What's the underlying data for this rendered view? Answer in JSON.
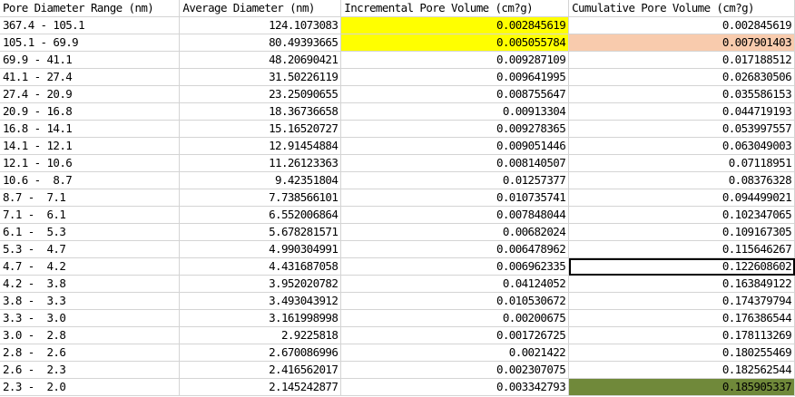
{
  "headers": [
    "Pore Diameter Range (nm)",
    "Average Diameter (nm)",
    "Incremental Pore Volume (cm?g)",
    "Cumulative Pore Volume (cm?g)"
  ],
  "rows": [
    [
      "367.4 - 105.1",
      "124.1073083",
      "0.002845619",
      "0.002845619"
    ],
    [
      "105.1 - 69.9",
      "80.49393665",
      "0.005055784",
      "0.007901403"
    ],
    [
      "69.9 - 41.1",
      "48.20690421",
      "0.009287109",
      "0.017188512"
    ],
    [
      "41.1 - 27.4",
      "31.50226119",
      "0.009641995",
      "0.026830506"
    ],
    [
      "27.4 - 20.9",
      "23.25090655",
      "0.008755647",
      "0.035586153"
    ],
    [
      "20.9 - 16.8",
      "18.36736658",
      "0.00913304",
      "0.044719193"
    ],
    [
      "16.8 - 14.1",
      "15.16520727",
      "0.009278365",
      "0.053997557"
    ],
    [
      "14.1 - 12.1",
      "12.91454884",
      "0.009051446",
      "0.063049003"
    ],
    [
      "12.1 - 10.6",
      "11.26123363",
      "0.008140507",
      "0.07118951"
    ],
    [
      "10.6 -  8.7",
      "9.42351804",
      "0.01257377",
      "0.08376328"
    ],
    [
      "8.7 -  7.1",
      "7.738566101",
      "0.010735741",
      "0.094499021"
    ],
    [
      "7.1 -  6.1",
      "6.552006864",
      "0.007848044",
      "0.102347065"
    ],
    [
      "6.1 -  5.3",
      "5.678281571",
      "0.00682024",
      "0.109167305"
    ],
    [
      "5.3 -  4.7",
      "4.990304991",
      "0.006478962",
      "0.115646267"
    ],
    [
      "4.7 -  4.2",
      "4.431687058",
      "0.006962335",
      "0.122608602"
    ],
    [
      "4.2 -  3.8",
      "3.952020782",
      "0.04124052",
      "0.163849122"
    ],
    [
      "3.8 -  3.3",
      "3.493043912",
      "0.010530672",
      "0.174379794"
    ],
    [
      "3.3 -  3.0",
      "3.161998998",
      "0.00200675",
      "0.176386544"
    ],
    [
      "3.0 -  2.8",
      "2.9225818",
      "0.001726725",
      "0.178113269"
    ],
    [
      "2.8 -  2.6",
      "2.670086996",
      "0.0021422",
      "0.180255469"
    ],
    [
      "2.6 -  2.3",
      "2.416562017",
      "0.002307075",
      "0.182562544"
    ],
    [
      "2.3 -  2.0",
      "2.145242877",
      "0.003342793",
      "0.185905337"
    ]
  ],
  "highlights": [
    {
      "row": 0,
      "col": 2,
      "color": "#ffff00"
    },
    {
      "row": 1,
      "col": 2,
      "color": "#ffff00"
    },
    {
      "row": 1,
      "col": 3,
      "color": "#f8cbad"
    },
    {
      "row": 21,
      "col": 3,
      "color": "#70893a"
    }
  ],
  "selected_cell": {
    "row": 14,
    "col": 3
  }
}
